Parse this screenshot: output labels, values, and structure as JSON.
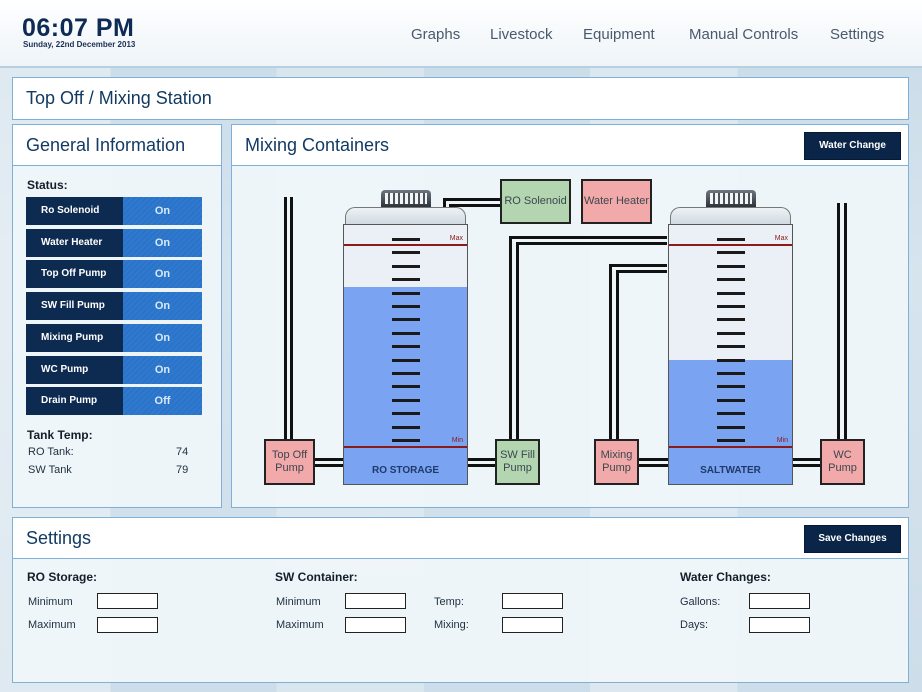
{
  "header": {
    "time": "06:07 PM",
    "date": "Sunday, 22nd December 2013",
    "nav": [
      "Graphs",
      "Livestock",
      "Equipment",
      "Manual Controls",
      "Settings"
    ]
  },
  "page_title": "Top Off / Mixing Station",
  "general": {
    "title": "General Information",
    "status_label": "Status:",
    "status": [
      {
        "label": "Ro Solenoid",
        "value": "On"
      },
      {
        "label": "Water Heater",
        "value": "On"
      },
      {
        "label": "Top Off Pump",
        "value": "On"
      },
      {
        "label": "SW Fill Pump",
        "value": "On"
      },
      {
        "label": "Mixing Pump",
        "value": "On"
      },
      {
        "label": "WC Pump",
        "value": "On"
      },
      {
        "label": "Drain Pump",
        "value": "Off"
      }
    ],
    "tank_temp_label": "Tank Temp:",
    "temps": [
      {
        "label": "RO Tank:",
        "value": "74"
      },
      {
        "label": "SW Tank",
        "value": "79"
      }
    ]
  },
  "mixing": {
    "title": "Mixing Containers",
    "water_change_label": "Water Change",
    "ro_solenoid": "RO Solenoid",
    "water_heater": "Water Heater",
    "top_off_pump": "Top Off Pump",
    "sw_fill_pump": "SW Fill Pump",
    "mixing_pump": "Mixing Pump",
    "wc_pump": "WC Pump",
    "ro_tank": {
      "name": "RO STORAGE",
      "max": "Max",
      "min": "Min",
      "level": 0.76
    },
    "sw_tank": {
      "name": "SALTWATER",
      "max": "Max",
      "min": "Min",
      "level": 0.48
    }
  },
  "settings": {
    "title": "Settings",
    "save_label": "Save Changes",
    "ro": {
      "title": "RO Storage:",
      "minimum": "Minimum",
      "maximum": "Maximum"
    },
    "sw": {
      "title": "SW Container:",
      "minimum": "Minimum",
      "maximum": "Maximum",
      "temp": "Temp:",
      "mixing": "Mixing:"
    },
    "wc": {
      "title": "Water Changes:",
      "gallons": "Gallons:",
      "days": "Days:"
    }
  },
  "colors": {
    "navy": "#0b2548",
    "blue": "#2f7ad0",
    "water": "#7aa3f2",
    "pink": "#f2a9a9",
    "green": "#b3d6b0"
  }
}
